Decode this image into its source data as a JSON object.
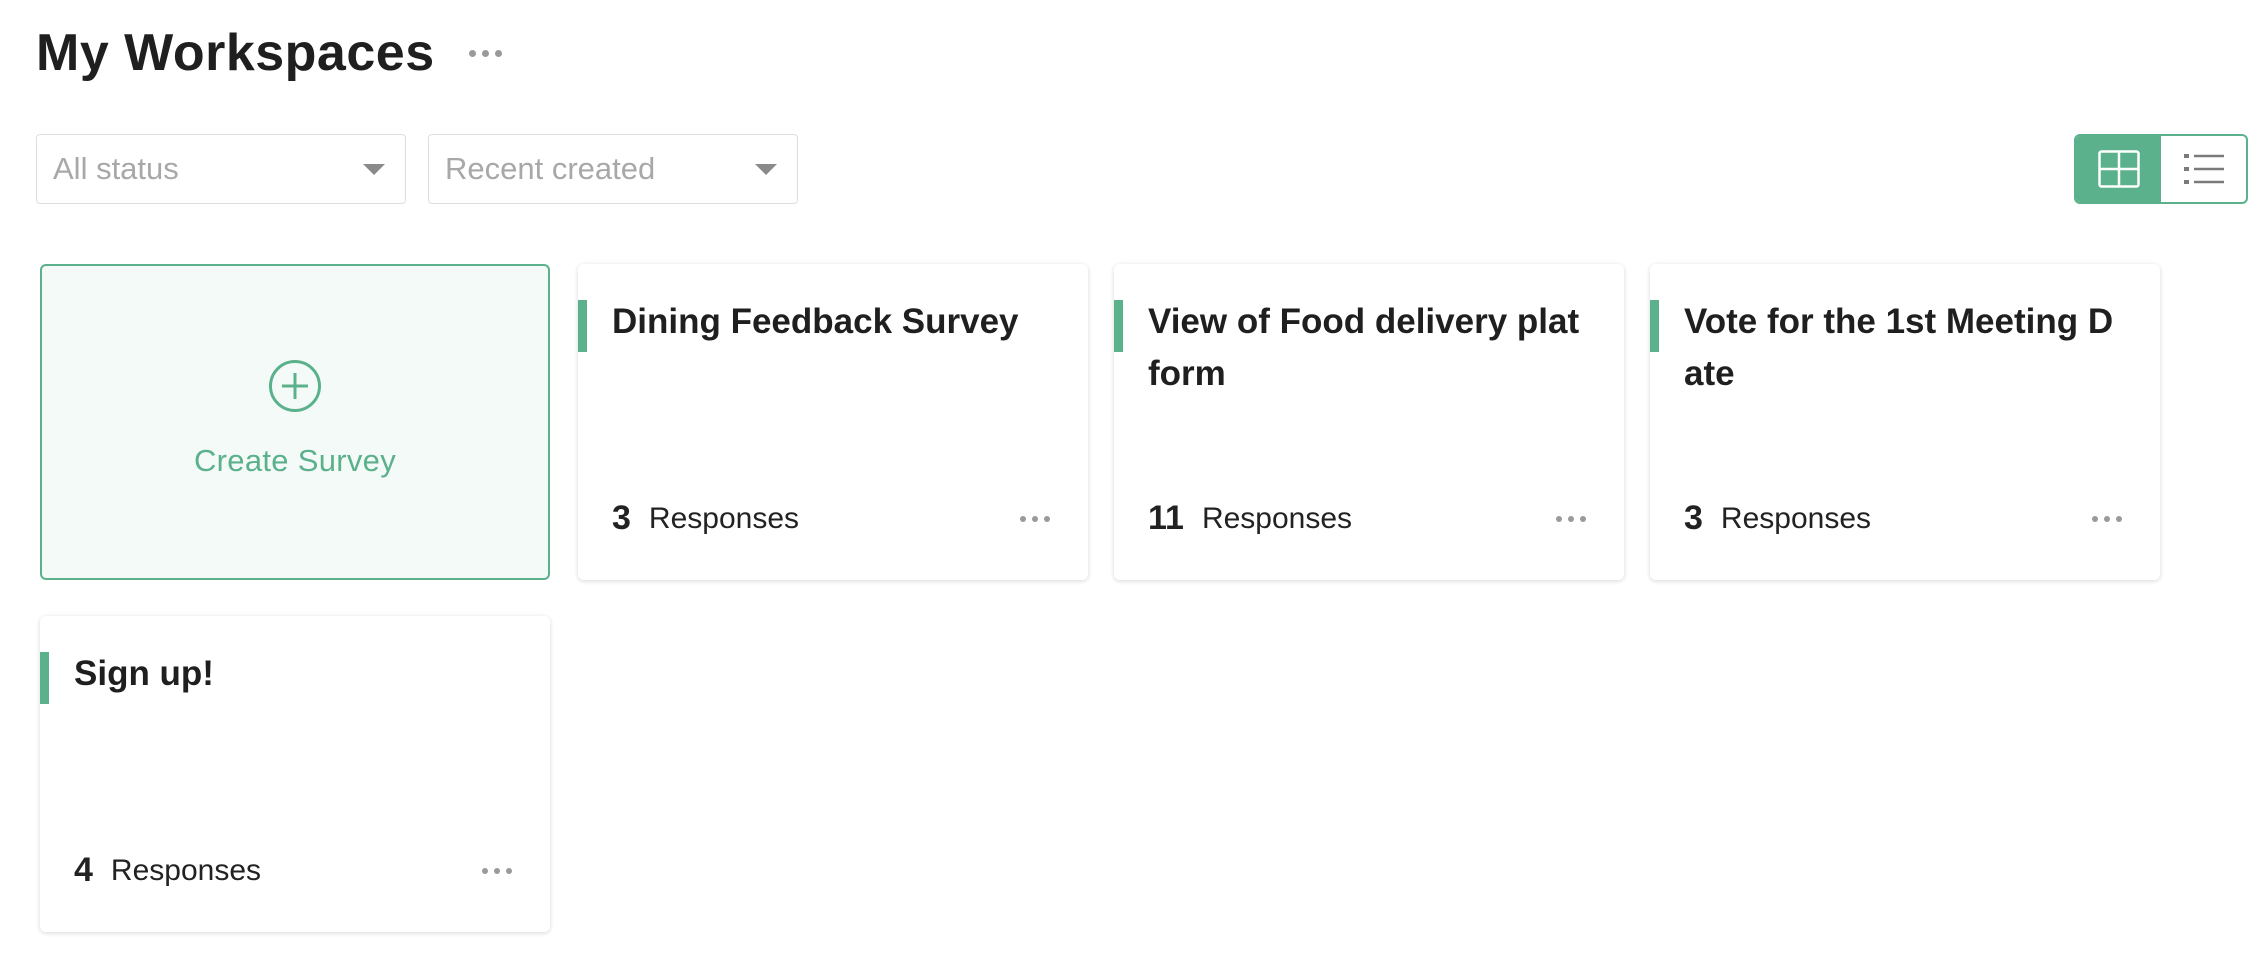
{
  "header": {
    "title": "My Workspaces",
    "more_icon": "more-horizontal-icon"
  },
  "filters": {
    "status": {
      "value": "All status",
      "icon": "caret-down-icon"
    },
    "sort": {
      "value": "Recent created",
      "icon": "caret-down-icon"
    }
  },
  "view_toggle": {
    "options": [
      {
        "name": "grid-view",
        "icon": "grid-icon",
        "active": true
      },
      {
        "name": "list-view",
        "icon": "list-icon",
        "active": false
      }
    ],
    "accent_color": "#5bb18b"
  },
  "create_card": {
    "label": "Create Survey",
    "icon": "plus-circle-icon"
  },
  "surveys": [
    {
      "title": "Dining Feedback Survey",
      "count": "3",
      "responses_label": "Responses"
    },
    {
      "title": "View of Food delivery platform",
      "count": "11",
      "responses_label": "Responses"
    },
    {
      "title": "Vote for the 1st Meeting Date",
      "count": "3",
      "responses_label": "Responses"
    },
    {
      "title": "Sign up!",
      "count": "4",
      "responses_label": "Responses"
    }
  ],
  "colors": {
    "accent": "#5bb18b",
    "create_card_bg": "#f4faf7",
    "text": "#1f1f1f",
    "muted": "#a8a8a8"
  }
}
